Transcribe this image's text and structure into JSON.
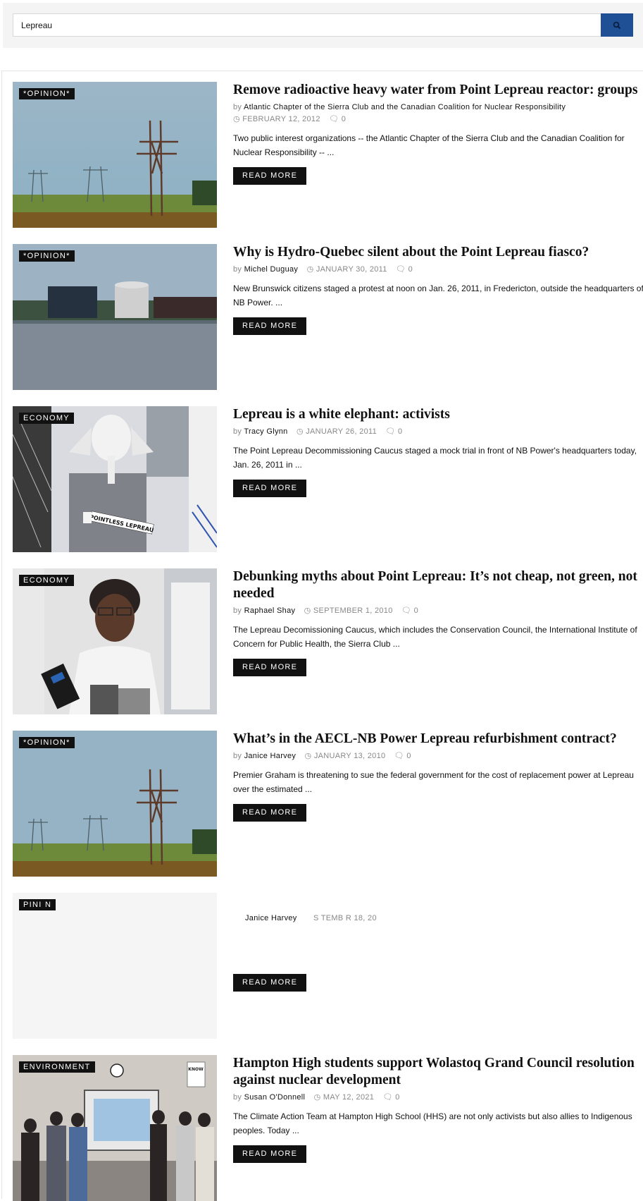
{
  "search": {
    "value": "Lepreau",
    "button_icon": "search-icon"
  },
  "articles": [
    {
      "category": "*OPINION*",
      "title": "Remove radioactive heavy water from Point Lepreau reactor: groups",
      "by": "by",
      "author": "Atlantic Chapter of the Sierra Club and the Canadian Coalition for Nuclear Responsibility",
      "date": "FEBRUARY 12, 2012",
      "comments": "0",
      "excerpt": "Two public interest organizations -- the Atlantic Chapter of the Sierra Club and the Canadian Coalition for Nuclear Responsibility -- ...",
      "read_more": "READ MORE"
    },
    {
      "category": "*OPINION*",
      "title": "Why is Hydro-Quebec silent about the Point Lepreau fiasco?",
      "by": "by",
      "author": "Michel Duguay",
      "date": "JANUARY 30, 2011",
      "comments": "0",
      "excerpt": "New Brunswick citizens staged a protest at noon on Jan. 26, 2011, in Fredericton, outside the headquarters of NB Power. ...",
      "read_more": "READ MORE"
    },
    {
      "category": "ECONOMY",
      "title": "Lepreau is a white elephant: activists",
      "by": "by",
      "author": "Tracy Glynn",
      "date": "JANUARY 26, 2011",
      "comments": "0",
      "excerpt": "The Point Lepreau Decommissioning Caucus staged a mock trial in front of NB Power's headquarters today, Jan. 26, 2011 in ...",
      "read_more": "READ MORE",
      "image_text": "POINTLESS LEPREAU"
    },
    {
      "category": "ECONOMY",
      "title": "Debunking myths about Point Lepreau: It’s not cheap, not green, not needed",
      "by": "by",
      "author": "Raphael Shay",
      "date": "SEPTEMBER 1, 2010",
      "comments": "0",
      "excerpt": "The Lepreau Decomissioning Caucus, which includes the Conservation Council, the International Institute of Concern for Public Health, the Sierra Club ...",
      "read_more": "READ MORE"
    },
    {
      "category": "*OPINION*",
      "title": "What’s in the AECL-NB Power Lepreau refurbishment contract?",
      "by": "by",
      "author": "Janice Harvey",
      "date": "JANUARY 13, 2010",
      "comments": "0",
      "excerpt": "Premier Graham is threatening to sue the federal government for the cost of replacement power at Lepreau over the estimated ...",
      "read_more": "READ MORE"
    },
    {
      "category": "PINI   N",
      "author": "Janice Harvey",
      "date_fragment": "S     TEMB  R 18, 20",
      "read_more": "READ MORE"
    },
    {
      "category": "ENVIRONMENT",
      "title": "Hampton High students support Wolastoq Grand Council resolution against nuclear development",
      "by": "by",
      "author": "Susan O'Donnell",
      "date": "MAY 12, 2021",
      "comments": "0",
      "excerpt": "The Climate Action Team at Hampton High School (HHS) are not only activists but also allies to Indigenous peoples. Today ...",
      "read_more": "READ MORE",
      "image_text": "KNOW"
    }
  ],
  "icons": {
    "date": "clock-icon",
    "comments": "comment-icon"
  },
  "colors": {
    "search_button": "#1f4f95",
    "label_bg": "#111111",
    "meta_text": "#888888"
  }
}
